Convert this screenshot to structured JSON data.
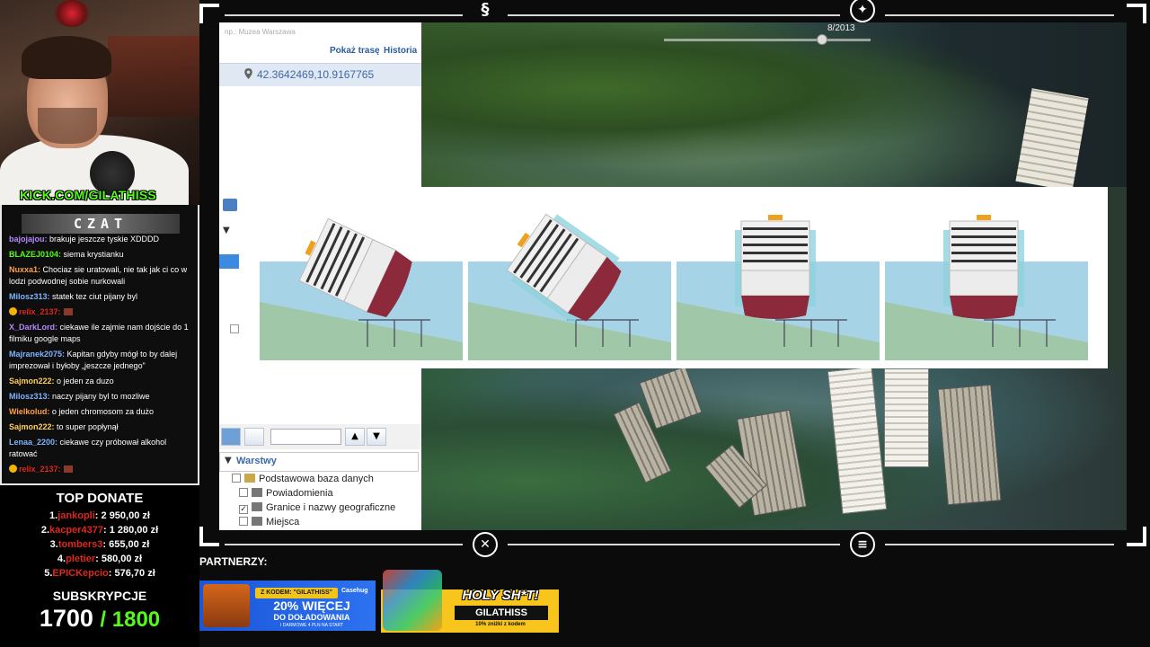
{
  "stream": {
    "channel_tag": "KICK.COM/GILATHISS",
    "chat_title": "CZAT",
    "top_donate_title": "TOP DONATE",
    "subs_title": "SUBSKRYPCJE",
    "subs_current": "1700",
    "subs_goal": "/ 1800",
    "partners_label": "PARTNERZY:"
  },
  "chat": {
    "messages": [
      {
        "user": "bajojajou:",
        "color": "#b388ff",
        "text": " brakuje jeszcze tyskie XDDDD"
      },
      {
        "user": "BLAZEJ0104:",
        "color": "#53fc18",
        "text": " siema krystianku"
      },
      {
        "user": "Nuxxa1:",
        "color": "#ff9f43",
        "text": " Chociaz sie uratowali, nie tak jak ci co w lodzi podwodnej sobie nurkowali"
      },
      {
        "user": "Milosz313:",
        "color": "#7fb3ff",
        "text": " statek tez ciut pijany byl"
      },
      {
        "user": "relix_2137:",
        "color": "#e0271b",
        "text": "",
        "emote": true
      },
      {
        "user": "X_DarkLord:",
        "color": "#b388ff",
        "text": " ciekawe ile zajmie nam dojście do 1 filmiku google maps"
      },
      {
        "user": "Majranek2075:",
        "color": "#7fb3ff",
        "text": " Kapitan gdyby mógł to by dalej imprezował i byłoby „jeszcze jednego”"
      },
      {
        "user": "Sajmon222:",
        "color": "#ffcf5c",
        "text": " o jeden za duzo"
      },
      {
        "user": "Milosz313:",
        "color": "#7fb3ff",
        "text": " naczy pijany byl to mozliwe"
      },
      {
        "user": "Wielkolud:",
        "color": "#ff9f43",
        "text": " o jeden chromosom za dużo"
      },
      {
        "user": "Sajmon222:",
        "color": "#ffcf5c",
        "text": " to super popłynął"
      },
      {
        "user": "Lenaa_2200:",
        "color": "#7fb3ff",
        "text": " ciekawe czy próbował alkohol ratować"
      },
      {
        "user": "relix_2137:",
        "color": "#e0271b",
        "text": "",
        "emote": true
      }
    ]
  },
  "donations": [
    {
      "rank": "1.",
      "name": "jankopli",
      "amount": ": 2 950,00 zł"
    },
    {
      "rank": "2.",
      "name": "kacper4377",
      "amount": ": 1 280,00 zł"
    },
    {
      "rank": "3.",
      "name": "tombers3",
      "amount": ": 655,00 zł"
    },
    {
      "rank": "4.",
      "name": "pletier",
      "amount": ": 580,00 zł"
    },
    {
      "rank": "5.",
      "name": "EPICKepcio",
      "amount": ": 576,70 zł"
    }
  ],
  "map_app": {
    "search_hint": "np.: Muzea Warszawa",
    "show_route_link": "Pokaż trasę",
    "history_link": "Historia",
    "coordinates": "42.3642469,10.9167765",
    "timeline_label": "8/2013",
    "layers_title": "Warstwy",
    "layers": [
      {
        "label": "Podstawowa baza danych",
        "checked": false,
        "level": 0
      },
      {
        "label": "Powiadomienia",
        "checked": false,
        "level": 1
      },
      {
        "label": "Granice i nazwy geograficzne",
        "checked": true,
        "level": 1
      },
      {
        "label": "Miejsca",
        "checked": false,
        "level": 1
      }
    ]
  },
  "banners": {
    "casehug_code": "Z KODEM: \"GILATHISS\"",
    "casehug_brand": "Casehug",
    "casehug_main": "20% WIĘCEJ",
    "casehug_sub": "DO DOŁADOWANIA",
    "casehug_small": "I DARMOWE 4 PLN NA START",
    "holy_title": "HOLY SH*T!",
    "holy_code": "GILATHISS",
    "holy_small": "10% zniżki z kodem"
  },
  "colors": {
    "kick_green": "#53fc18",
    "donate_name_red": "#e0271b",
    "hull_red": "#8c2a3c",
    "water_blue": "#a7d3e6"
  }
}
